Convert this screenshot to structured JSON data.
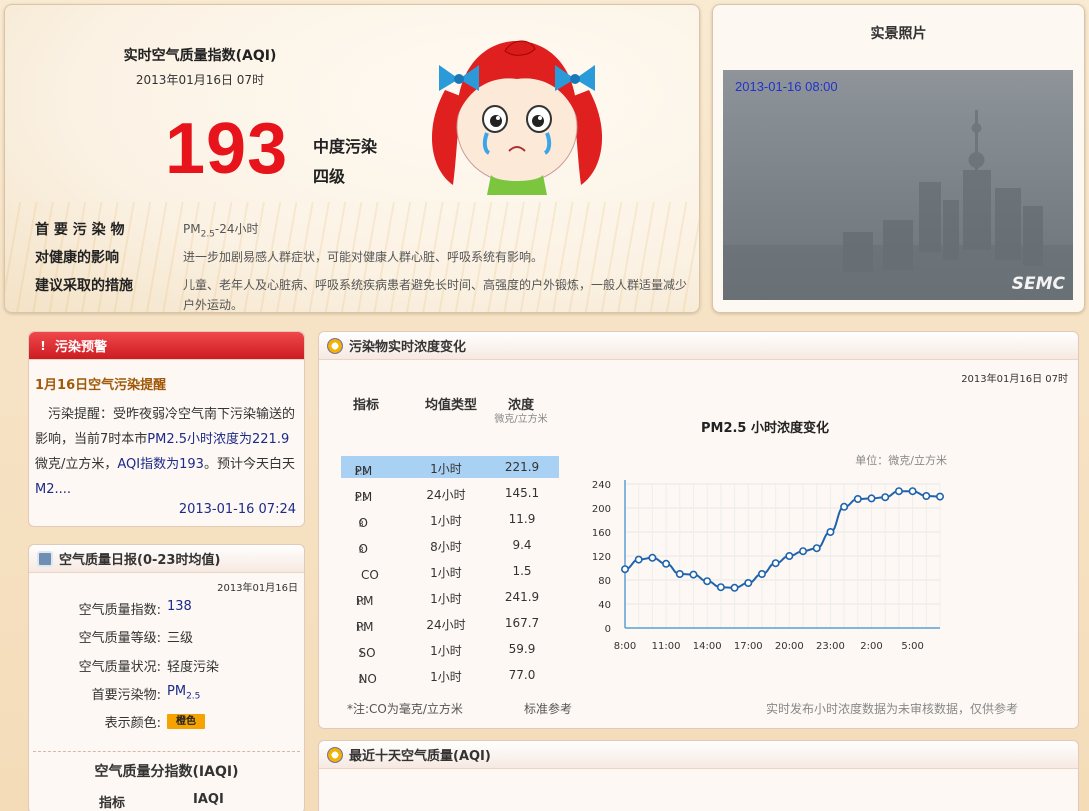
{
  "aqi": {
    "title": "实时空气质量指数(AQI)",
    "time": "2013年01月16日 07时",
    "value": "193",
    "level": "中度污染",
    "grade": "四级",
    "value_color": "#e8141b",
    "primary_label": "首 要 污 染 物",
    "primary_main": "PM",
    "primary_sub": "2.5",
    "primary_suffix": "-24小时",
    "health_label": "对健康的影响",
    "health_text": "进一步加剧易感人群症状，可能对健康人群心脏、呼吸系统有影响。",
    "measure_label": "建议采取的措施",
    "measure_text": "儿童、老年人及心脏病、呼吸系统疾病患者避免长时间、高强度的户外锻炼，一般人群适量减少户外运动。"
  },
  "photo": {
    "title": "实景照片",
    "stamp": "2013-01-16 08:00",
    "logo": "SEMC"
  },
  "warning": {
    "header": "污染预警",
    "title": "1月16日空气污染提醒",
    "text_a": "　污染提醒：受昨夜弱冷空气南下污染输送的影响，当前7时本市",
    "text_b": "PM2.5小时浓度为221.9",
    "text_c": "微克/立方米，",
    "text_d": "AQI指数为193",
    "text_e": "。预计今天白天",
    "text_f": "M2....",
    "time": "2013-01-16 07:24"
  },
  "daily": {
    "header": "空气质量日报(0-23时均值)",
    "date": "2013年01月16日",
    "rows": [
      {
        "label": "空气质量指数:",
        "value": "138"
      },
      {
        "label": "空气质量等级:",
        "value": "三级"
      },
      {
        "label": "空气质量状况:",
        "value": "轻度污染"
      },
      {
        "label": "首要污染物:",
        "value": "PM",
        "sub": "2.5"
      },
      {
        "label": "表示颜色:",
        "value": "橙色"
      }
    ],
    "color_hex": "#f4a300",
    "iaqi_title": "空气质量分指数(IAQI)",
    "iaqi_h1": "指标",
    "iaqi_h2": "IAQI"
  },
  "concentration": {
    "header": "污染物实时浓度变化",
    "date": "2013年01月16日 07时",
    "headers": {
      "indicator": "指标",
      "avg_type": "均值类型",
      "conc": "浓度",
      "unit": "微克/立方米"
    },
    "rows": [
      {
        "main": "PM",
        "sub": "2.5",
        "type": "1小时",
        "value": "221.9",
        "selected": true
      },
      {
        "main": "PM",
        "sub": "2.5",
        "type": "24小时",
        "value": "145.1",
        "selected": false
      },
      {
        "main": "O",
        "sub": "3",
        "type": "1小时",
        "value": "11.9",
        "selected": false
      },
      {
        "main": "O",
        "sub": "3",
        "type": "8小时",
        "value": "9.4",
        "selected": false
      },
      {
        "main": "CO",
        "sub": "",
        "type": "1小时",
        "value": "1.5",
        "selected": false
      },
      {
        "main": "PM",
        "sub": "10",
        "type": "1小时",
        "value": "241.9",
        "selected": false
      },
      {
        "main": "PM",
        "sub": "10",
        "type": "24小时",
        "value": "167.7",
        "selected": false
      },
      {
        "main": "SO",
        "sub": "2",
        "type": "1小时",
        "value": "59.9",
        "selected": false
      },
      {
        "main": "NO",
        "sub": "2",
        "type": "1小时",
        "value": "77.0",
        "selected": false
      }
    ],
    "note": "*注:CO为毫克/立方米",
    "std": "标准参考",
    "disclaimer": "实时发布小时浓度数据为未审核数据，仅供参考"
  },
  "ten_day": {
    "header": "最近十天空气质量(AQI)"
  },
  "chart_data": {
    "type": "line",
    "title": "PM2.5 小时浓度变化",
    "unit_label": "单位：微克/立方米",
    "x_tick_labels": [
      "8:00",
      "11:00",
      "14:00",
      "17:00",
      "20:00",
      "23:00",
      "2:00",
      "5:00"
    ],
    "y_ticks": [
      0,
      40,
      80,
      120,
      160,
      200,
      240
    ],
    "ylim": [
      0,
      240
    ],
    "series": [
      {
        "values": [
          98,
          114,
          117,
          107,
          90,
          89,
          78,
          68,
          67,
          75,
          90,
          108,
          120,
          128,
          133,
          160,
          202,
          215,
          216,
          218,
          228,
          228,
          220,
          219
        ],
        "color": "#1f63ad"
      }
    ],
    "grid": true,
    "hours": [
      "8:00",
      "9:00",
      "10:00",
      "11:00",
      "12:00",
      "13:00",
      "14:00",
      "15:00",
      "16:00",
      "17:00",
      "18:00",
      "19:00",
      "20:00",
      "21:00",
      "22:00",
      "23:00",
      "0:00",
      "1:00",
      "2:00",
      "3:00",
      "4:00",
      "5:00",
      "6:00",
      "7:00"
    ]
  }
}
